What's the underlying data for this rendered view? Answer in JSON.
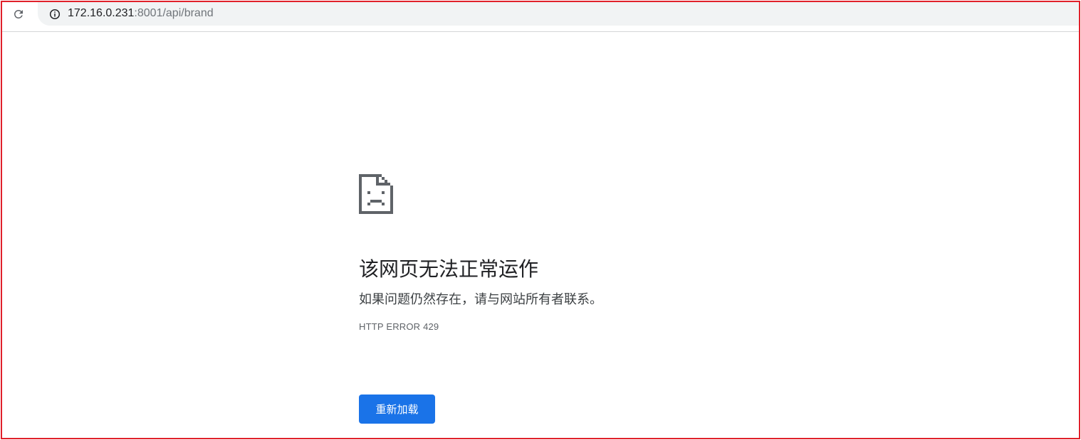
{
  "browser": {
    "reload_icon": "reload-icon",
    "info_icon": "info-icon",
    "url_host": "172.16.0.231",
    "url_rest": ":8001/api/brand"
  },
  "error_page": {
    "icon": "sad-page-icon",
    "heading": "该网页无法正常运作",
    "message": "如果问题仍然存在，请与网站所有者联系。",
    "error_code": "HTTP ERROR 429",
    "reload_label": "重新加载"
  },
  "colors": {
    "frame_border": "#e0202a",
    "primary_button": "#1a73e8",
    "omnibox_bg": "#f1f3f4"
  }
}
